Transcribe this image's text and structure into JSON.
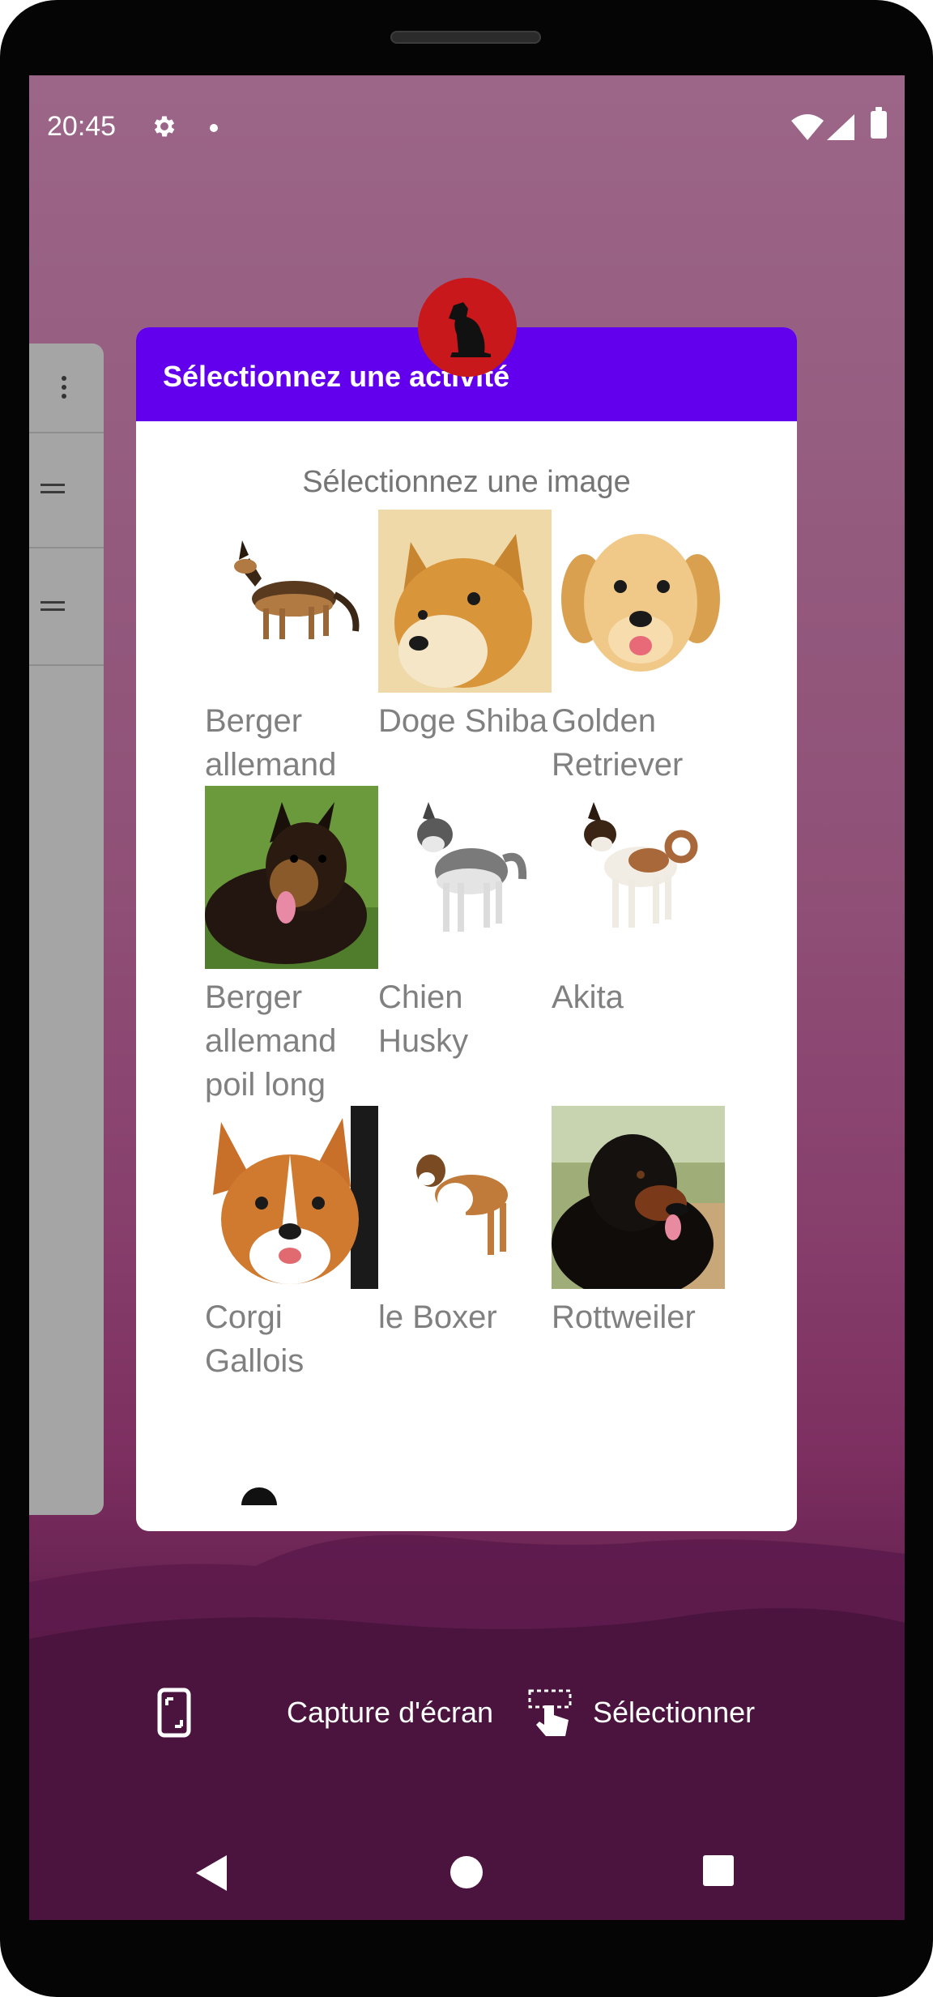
{
  "status_bar": {
    "time": "20:45",
    "icons": [
      "gear-icon",
      "notification-dot-icon",
      "wifi-icon",
      "signal-icon",
      "battery-icon"
    ]
  },
  "recent_app": {
    "title": "Sélectionnez une activité",
    "subtitle": "Sélectionnez une image",
    "header_color": "#6200ee",
    "icon": "dog-app-icon",
    "items": [
      {
        "label": "Berger allemand",
        "image": "german-shepherd"
      },
      {
        "label": "Doge Shiba",
        "image": "shiba-inu"
      },
      {
        "label": "Golden Retriever",
        "image": "golden-retriever"
      },
      {
        "label": "Berger allemand poil long",
        "image": "long-haired-german-shepherd"
      },
      {
        "label": "Chien Husky",
        "image": "husky"
      },
      {
        "label": "Akita",
        "image": "akita"
      },
      {
        "label": "Corgi Gallois",
        "image": "welsh-corgi"
      },
      {
        "label": "le Boxer",
        "image": "boxer"
      },
      {
        "label": "Rottweiler",
        "image": "rottweiler"
      }
    ]
  },
  "overview_actions": {
    "screenshot_label": "Capture d'écran",
    "select_label": "Sélectionner"
  },
  "nav": {
    "back": "back-icon",
    "home": "home-icon",
    "recents": "recents-icon"
  }
}
